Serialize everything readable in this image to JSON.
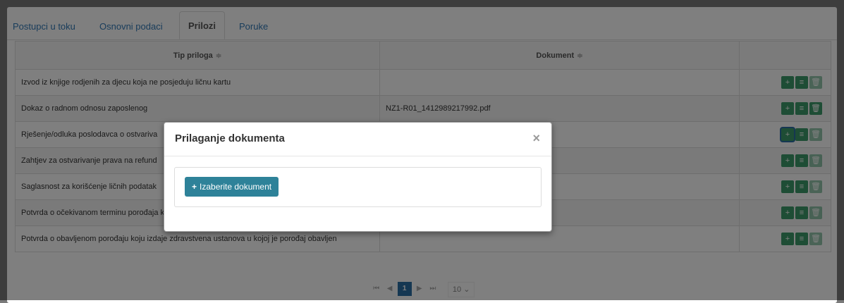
{
  "tabs": [
    {
      "label": "Postupci u toku"
    },
    {
      "label": "Osnovni podaci"
    },
    {
      "label": "Prilozi"
    },
    {
      "label": "Poruke"
    }
  ],
  "table": {
    "headers": {
      "tip": "Tip priloga",
      "dokument": "Dokument",
      "sort_icon": "≑"
    },
    "rows": [
      {
        "tip": "Izvod iz knjige rodjenih za djecu koja ne posjeduju ličnu kartu",
        "dokument": ""
      },
      {
        "tip": "Dokaz o radnom odnosu zaposlenog",
        "dokument": "NZ1-R01_1412989217992.pdf"
      },
      {
        "tip": "Rješenje/odluka poslodavca o ostvariva",
        "dokument": ""
      },
      {
        "tip": "Zahtjev za ostvarivanje prava na refund",
        "dokument": ""
      },
      {
        "tip": "Saglasnost za korišćenje ličnih podatak",
        "dokument": ""
      },
      {
        "tip": "Potvrda o očekivanom terminu porođaja koju izdaje izabrani ginekolog",
        "dokument": ""
      },
      {
        "tip": "Potvrda o obavljenom porođaju koju izdaje zdravstvena ustanova u kojoj je porođaj obavljen",
        "dokument": ""
      }
    ],
    "action_icons": {
      "add": "+",
      "list": "≡",
      "delete": "🗑"
    }
  },
  "pager": {
    "first": "⏮",
    "prev": "◀",
    "current": "1",
    "next": "▶",
    "last": "⏭",
    "page_size": "10"
  },
  "modal": {
    "title": "Prilaganje dokumenta",
    "close": "×",
    "choose_button": "Izaberite dokument",
    "choose_icon": "+"
  },
  "colors": {
    "action_green": "#3d9a6a",
    "choose_button": "#2e8299",
    "pager_active": "#2a6ea5"
  }
}
